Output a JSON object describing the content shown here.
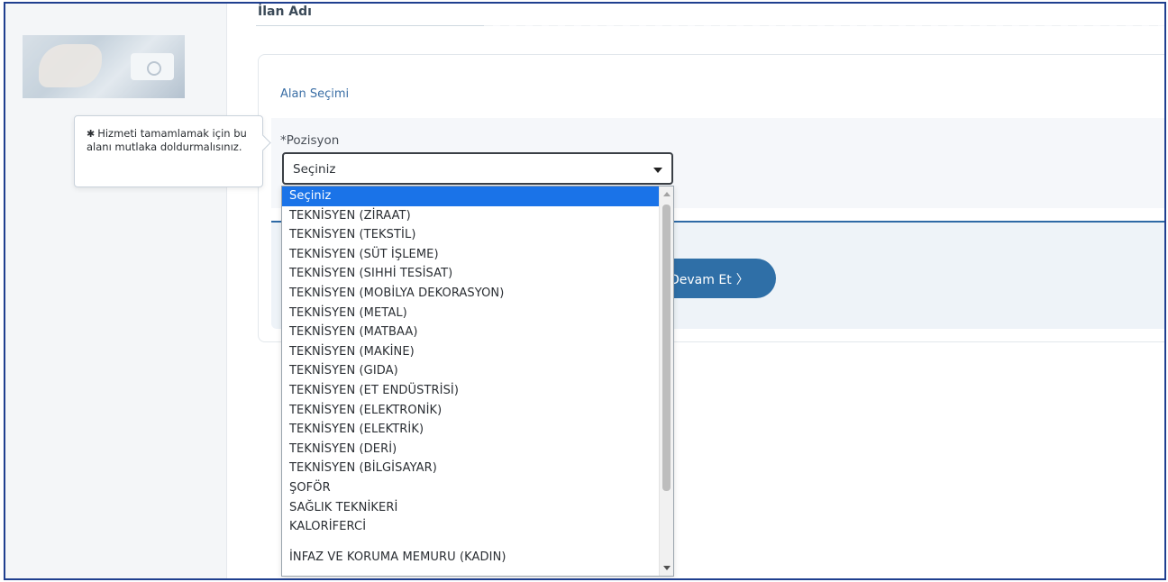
{
  "tooltip": {
    "star": "✱",
    "text": "Hizmeti tamamlamak için bu alanı mutlaka doldurmalısınız."
  },
  "header": {
    "title": "İlan Adı"
  },
  "form": {
    "section_title": "Alan Seçimi",
    "position_label": "*Pozisyon",
    "position_value": "Seçiniz",
    "continue_label": "Devam Et"
  },
  "dropdown": {
    "options": [
      "Seçiniz",
      "TEKNİSYEN (ZİRAAT)",
      "TEKNİSYEN (TEKSTİL)",
      "TEKNİSYEN (SÜT İŞLEME)",
      "TEKNİSYEN (SIHHİ TESİSAT)",
      "TEKNİSYEN (MOBİLYA DEKORASYON)",
      "TEKNİSYEN (METAL)",
      "TEKNİSYEN (MATBAA)",
      "TEKNİSYEN (MAKİNE)",
      "TEKNİSYEN (GIDA)",
      "TEKNİSYEN (ET ENDÜSTRİSİ)",
      "TEKNİSYEN (ELEKTRONİK)",
      "TEKNİSYEN (ELEKTRİK)",
      "TEKNİSYEN (DERİ)",
      "TEKNİSYEN (BİLGİSAYAR)",
      "ŞOFÖR",
      "SAĞLIK TEKNİKERİ",
      "KALORİFERCİ",
      "",
      "İNFAZ VE KORUMA MEMURU (KADIN)"
    ],
    "selected_index": 0
  },
  "colors": {
    "accent": "#2f6fa7",
    "selection": "#1a73e8",
    "frame_border": "#1f3f8f"
  }
}
